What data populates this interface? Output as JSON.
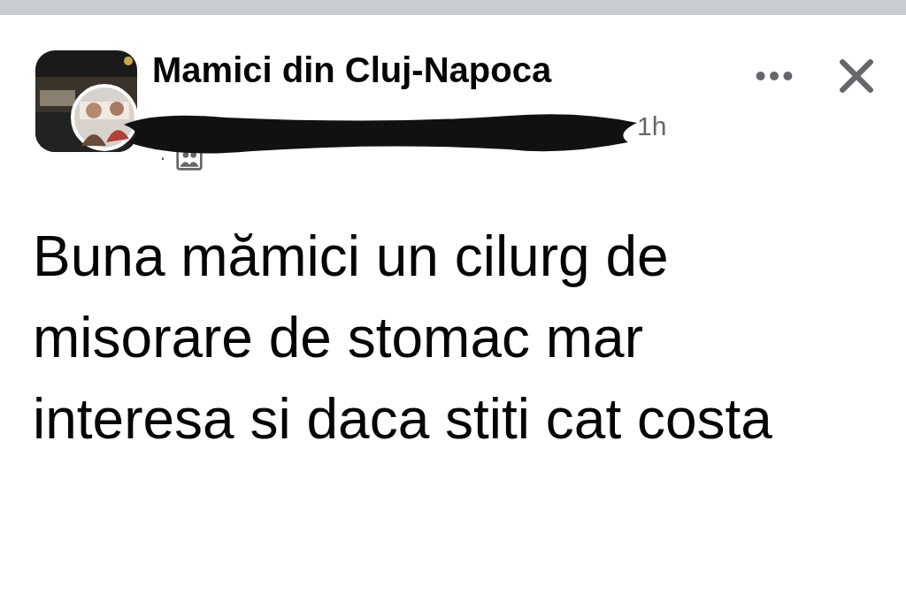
{
  "post": {
    "group_name": "Mamici din Cluj-Napoca",
    "time": "1h",
    "separator": "·",
    "text": "Buna mămici un cilurg de misorare de stomac mar interesa si daca stiti cat costa"
  }
}
